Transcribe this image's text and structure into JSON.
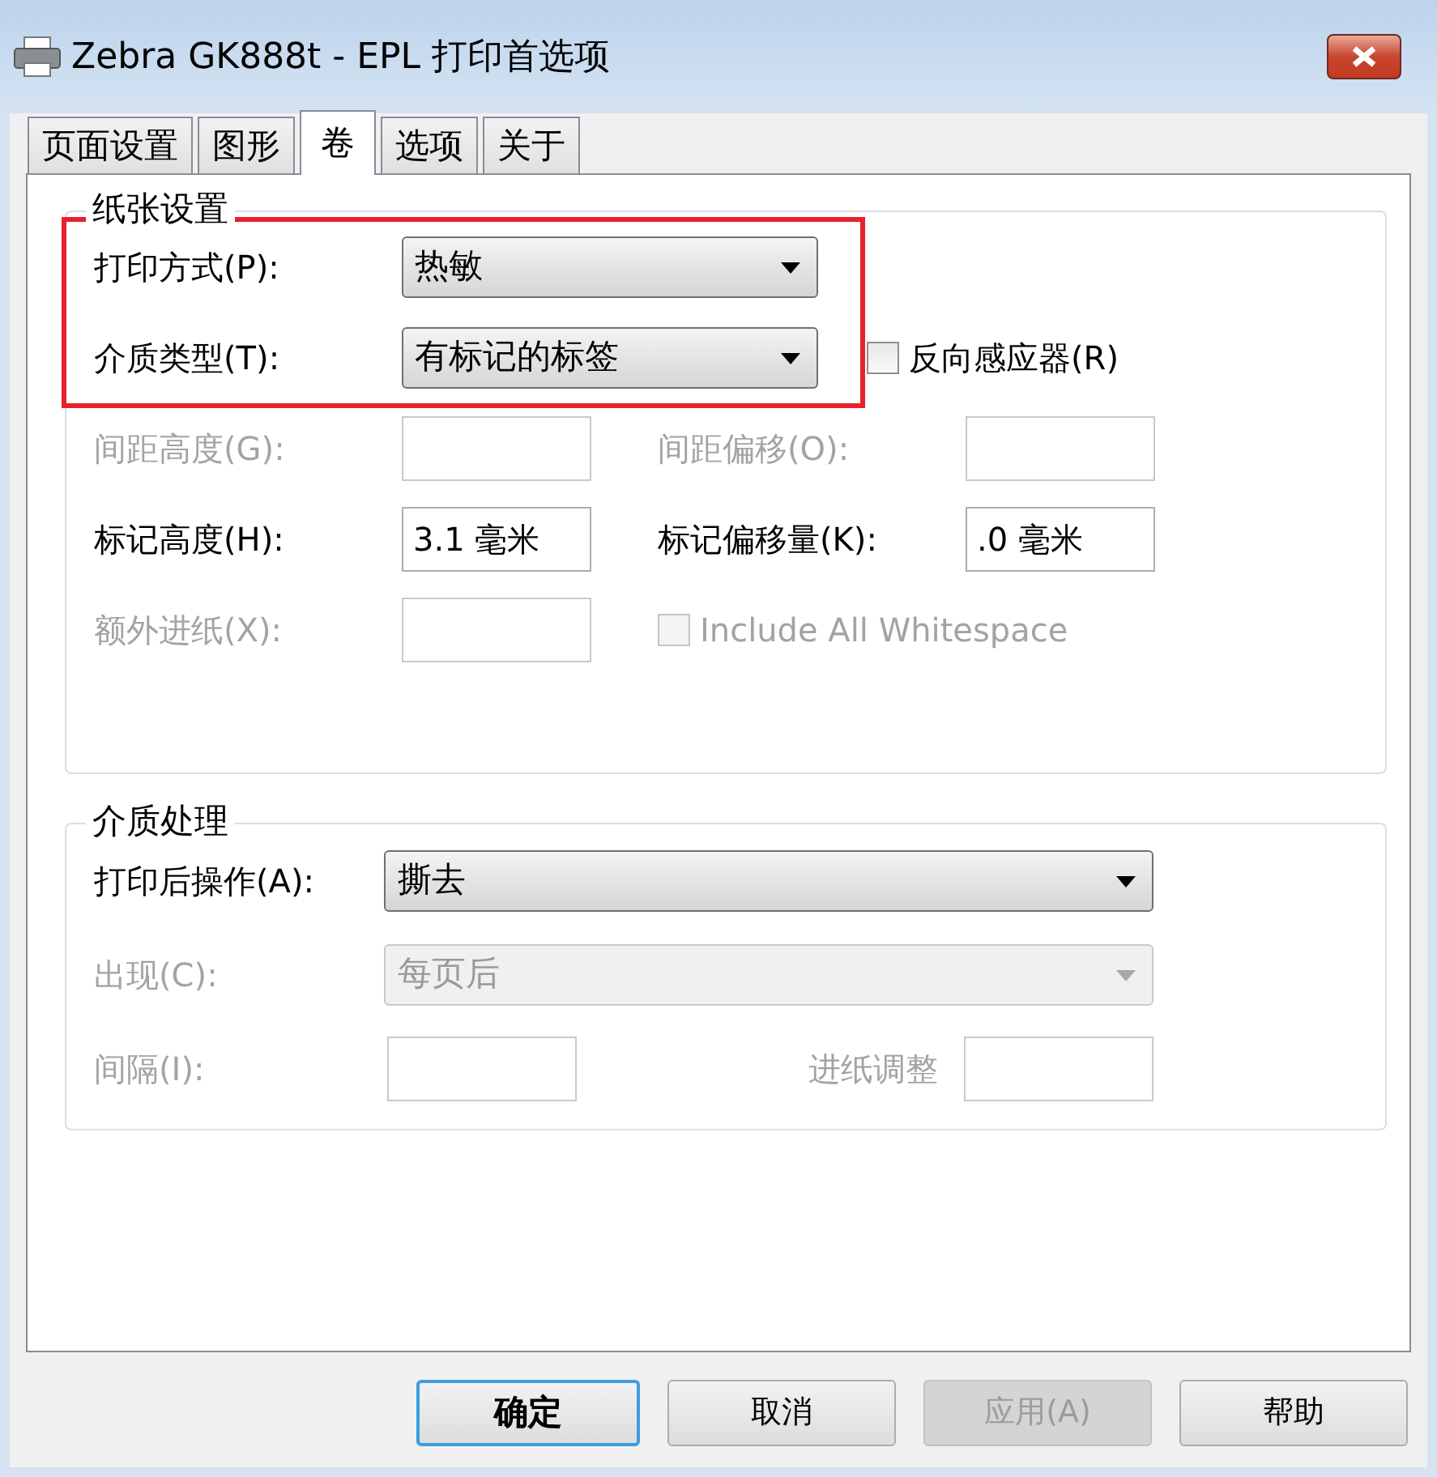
{
  "window": {
    "title": "Zebra GK888t - EPL 打印首选项"
  },
  "tabs": [
    {
      "label": "页面设置",
      "selected": false
    },
    {
      "label": "图形",
      "selected": false
    },
    {
      "label": "卷",
      "selected": true
    },
    {
      "label": "选项",
      "selected": false
    },
    {
      "label": "关于",
      "selected": false
    }
  ],
  "groups": [
    {
      "title": "纸张设置",
      "rows": [
        {
          "highlighted": true,
          "fields": [
            {
              "kind": "dropdown",
              "label": "打印方式(P):",
              "value": "热敏",
              "disabled": false
            }
          ]
        },
        {
          "highlighted": true,
          "fields": [
            {
              "kind": "dropdown",
              "label": "介质类型(T):",
              "value": "有标记的标签",
              "disabled": false
            },
            {
              "kind": "checkbox",
              "label": "反向感应器(R)",
              "checked": false,
              "disabled": false
            }
          ]
        },
        {
          "highlighted": false,
          "fields": [
            {
              "kind": "input",
              "label": "间距高度(G):",
              "disabled": true
            },
            {
              "kind": "input",
              "label": "间距偏移(O):",
              "disabled": true
            }
          ]
        },
        {
          "highlighted": false,
          "fields": [
            {
              "kind": "input",
              "label": "标记高度(H):",
              "value": "3.1 毫米",
              "disabled": false
            },
            {
              "kind": "input",
              "label": "标记偏移量(K):",
              "value": ".0 毫米",
              "disabled": false
            }
          ]
        },
        {
          "highlighted": false,
          "fields": [
            {
              "kind": "input",
              "label": "额外进纸(X):",
              "disabled": true
            },
            {
              "kind": "checkbox",
              "label": "Include All Whitespace",
              "checked": false,
              "disabled": true
            }
          ]
        }
      ]
    },
    {
      "title": "介质处理",
      "rows": [
        {
          "highlighted": false,
          "fields": [
            {
              "kind": "dropdown",
              "label": "打印后操作(A):",
              "value": "撕去",
              "disabled": false
            }
          ]
        },
        {
          "highlighted": false,
          "fields": [
            {
              "kind": "dropdown",
              "label": "出现(C):",
              "value": "每页后",
              "disabled": true
            }
          ]
        },
        {
          "highlighted": false,
          "fields": [
            {
              "kind": "input",
              "label": "间隔(I):",
              "disabled": true
            },
            {
              "kind": "input",
              "label": "进纸调整",
              "disabled": true
            }
          ]
        }
      ]
    }
  ],
  "buttons": [
    {
      "label": "确定",
      "default": true,
      "disabled": false
    },
    {
      "label": "取消",
      "default": false,
      "disabled": false
    },
    {
      "label": "应用(A)",
      "default": false,
      "disabled": true
    },
    {
      "label": "帮助",
      "default": false,
      "disabled": false
    }
  ]
}
